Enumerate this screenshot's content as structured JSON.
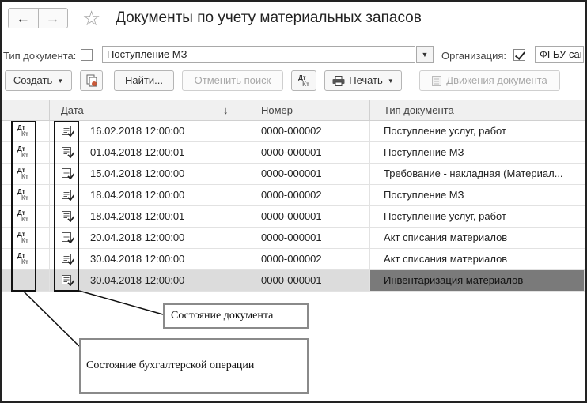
{
  "window": {
    "title": "Документы по учету материальных запасов",
    "back_icon": "←",
    "forward_icon": "→",
    "favorite_icon": "☆"
  },
  "filters": {
    "doc_type_label": "Тип документа:",
    "doc_type_value": "Поступление МЗ",
    "org_label": "Организация:",
    "org_value": "ФГБУ сан"
  },
  "toolbar": {
    "create_label": "Создать",
    "find_label": "Найти...",
    "cancel_search_label": "Отменить поиск",
    "dt_label": "Дт",
    "kt_label": "Кт",
    "print_label": "Печать",
    "movements_label": "Движения документа"
  },
  "table": {
    "columns": {
      "date": "Дата",
      "number": "Номер",
      "type": "Тип документа"
    },
    "sort_indicator": "↓",
    "rows": [
      {
        "dt": "Дт",
        "kt": "Кт",
        "date": "16.02.2018 12:00:00",
        "number": "0000-000002",
        "type": "Поступление услуг, работ"
      },
      {
        "dt": "Дт",
        "kt": "Кт",
        "date": "01.04.2018 12:00:01",
        "number": "0000-000001",
        "type": "Поступление МЗ"
      },
      {
        "dt": "Дт",
        "kt": "Кт",
        "date": "15.04.2018 12:00:00",
        "number": "0000-000001",
        "type": "Требование - накладная (Материал..."
      },
      {
        "dt": "Дт",
        "kt": "Кт",
        "date": "18.04.2018 12:00:00",
        "number": "0000-000002",
        "type": "Поступление МЗ"
      },
      {
        "dt": "Дт",
        "kt": "Кт",
        "date": "18.04.2018 12:00:01",
        "number": "0000-000001",
        "type": "Поступление услуг, работ"
      },
      {
        "dt": "Дт",
        "kt": "Кт",
        "date": "20.04.2018 12:00:00",
        "number": "0000-000001",
        "type": "Акт списания материалов"
      },
      {
        "dt": "Дт",
        "kt": "Кт",
        "date": "30.04.2018 12:00:00",
        "number": "0000-000002",
        "type": "Акт списания материалов"
      },
      {
        "dt": "",
        "kt": "",
        "date": "30.04.2018 12:00:00",
        "number": "0000-000001",
        "type": "Инвентаризация материалов"
      }
    ]
  },
  "annotations": {
    "doc_state": "Состояние документа",
    "accounting_state": "Состояние бухгалтерской операции"
  }
}
